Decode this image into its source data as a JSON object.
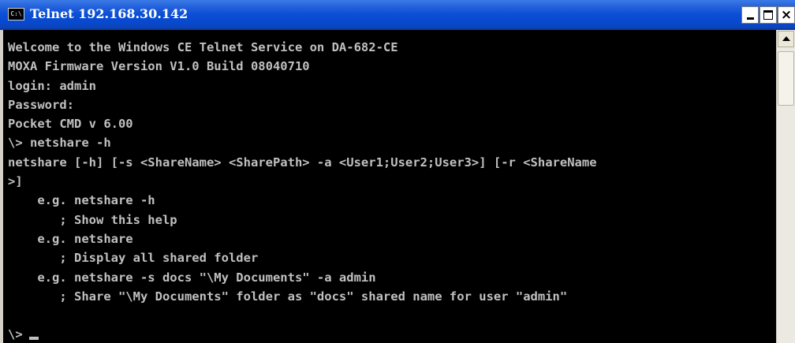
{
  "window": {
    "title": "Telnet 192.168.30.142",
    "icon_label": "C:\\",
    "icon_name": "console-icon",
    "buttons": {
      "minimize": "minimize-icon",
      "maximize": "maximize-icon",
      "close": "×"
    }
  },
  "console": {
    "lines": [
      "Welcome to the Windows CE Telnet Service on DA-682-CE",
      "MOXA Firmware Version V1.0 Build 08040710",
      "login: admin",
      "Password:",
      "Pocket CMD v 6.00",
      "\\> netshare -h",
      "netshare [-h] [-s <ShareName> <SharePath> -a <User1;User2;User3>] [-r <ShareName",
      ">]",
      "    e.g. netshare -h",
      "       ; Show this help",
      "    e.g. netshare",
      "       ; Display all shared folder",
      "    e.g. netshare -s docs \"\\My Documents\" -a admin",
      "       ; Share \"\\My Documents\" folder as \"docs\" shared name for user \"admin\""
    ],
    "prompt": "\\>"
  },
  "colors": {
    "titlebar": "#0a4fd6",
    "console_bg": "#000000",
    "console_text": "#c0c0c0"
  }
}
